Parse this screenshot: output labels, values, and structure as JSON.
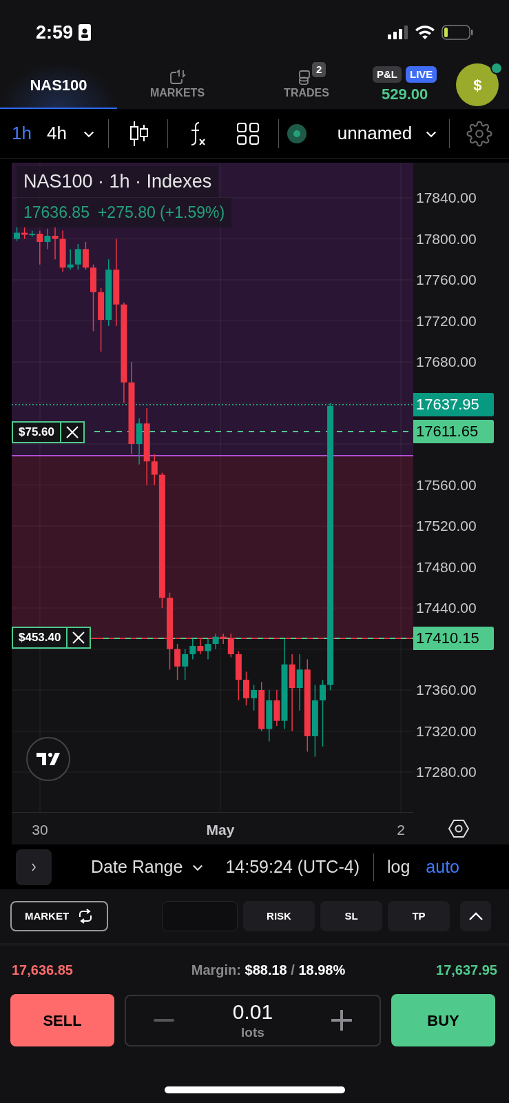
{
  "status_bar": {
    "time": "2:59"
  },
  "nav": {
    "tabs": [
      {
        "label": "NAS100",
        "selected": true
      },
      {
        "label": "MARKETS",
        "selected": false
      },
      {
        "label": "TRADES",
        "selected": false,
        "badge": "2"
      }
    ],
    "pnl": {
      "label": "P&L",
      "mode": "LIVE",
      "value": "529.00"
    },
    "account": {
      "symbol": "$",
      "online": true
    }
  },
  "toolbar": {
    "intervals": [
      {
        "label": "1h",
        "selected": true
      },
      {
        "label": "4h",
        "selected": false
      }
    ],
    "layout_name": "unnamed"
  },
  "chart": {
    "title": "NAS100 · 1h · Indexes",
    "price": "17636.85",
    "change": "+275.80 (+1.59%)",
    "price_ticks": [
      "17840.00",
      "17800.00",
      "17760.00",
      "17720.00",
      "17680.00",
      "17560.00",
      "17520.00",
      "17480.00",
      "17440.00",
      "17360.00",
      "17320.00",
      "17280.00"
    ],
    "price_tags": [
      {
        "text": "17637.95",
        "kind": "ask"
      },
      {
        "text": "17611.65",
        "kind": "order"
      },
      {
        "text": "17410.15",
        "kind": "order"
      }
    ],
    "orders": [
      {
        "pnl": "$75.60"
      },
      {
        "pnl": "$453.40"
      }
    ],
    "time_ticks": [
      {
        "label": "30",
        "bold": false
      },
      {
        "label": "May",
        "bold": true
      },
      {
        "label": "2",
        "bold": false
      }
    ]
  },
  "range_bar": {
    "date_range": "Date Range",
    "time": "14:59:24 (UTC-4)",
    "scales": [
      {
        "label": "log",
        "selected": false
      },
      {
        "label": "auto",
        "selected": true
      }
    ]
  },
  "order_panel": {
    "type": "MARKET",
    "tabs": [
      "RISK",
      "SL",
      "TP"
    ],
    "bid": "17,636.85",
    "margin": "Margin: **$88.18** / **18.98%**",
    "ask": "17,637.95",
    "sell": "SELL",
    "buy": "BUY",
    "quantity": "0.01",
    "unit": "lots"
  }
}
